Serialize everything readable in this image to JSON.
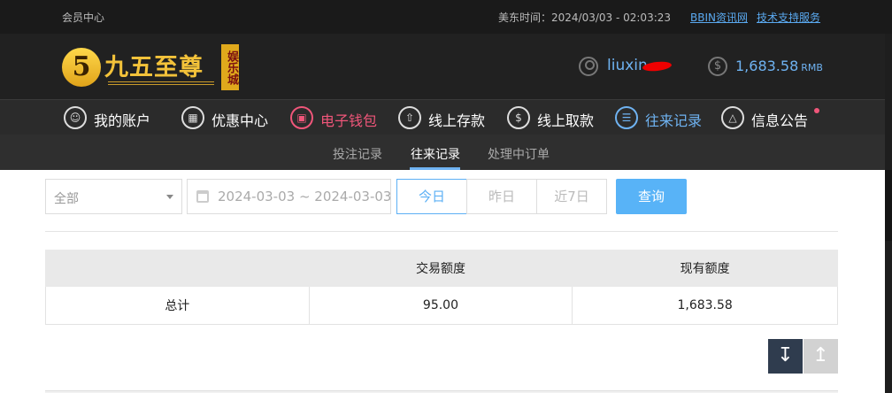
{
  "topbar": {
    "member_center": "会员中心",
    "time_label": "美东时间：2024/03/03 - 02:03:23",
    "link_bbin": "BBIN资讯网",
    "link_support": "技术支持服务"
  },
  "logo": {
    "mark": "5",
    "name": "九五至尊",
    "tag": "娱乐城"
  },
  "user": {
    "username": "liuxin",
    "balance": "1,683.58",
    "currency": "RMB",
    "balance_icon": "$"
  },
  "nav": {
    "items": [
      {
        "label": "我的账户",
        "icon": "user-icon"
      },
      {
        "label": "优惠中心",
        "icon": "gift-icon"
      },
      {
        "label": "电子钱包",
        "icon": "wallet-icon"
      },
      {
        "label": "线上存款",
        "icon": "deposit-icon"
      },
      {
        "label": "线上取款",
        "icon": "withdraw-icon"
      },
      {
        "label": "往来记录",
        "icon": "records-icon"
      },
      {
        "label": "信息公告",
        "icon": "bell-icon"
      }
    ]
  },
  "subnav": {
    "tabs": [
      {
        "label": "投注记录"
      },
      {
        "label": "往来记录"
      },
      {
        "label": "处理中订单"
      }
    ]
  },
  "filters": {
    "type_select": "全部",
    "date_range": "2024-03-03 ~ 2024-03-03",
    "quick": [
      "今日",
      "昨日",
      "近7日"
    ],
    "query_button": "查询"
  },
  "summary_table": {
    "headers": [
      "",
      "交易额度",
      "现有额度"
    ],
    "row": [
      "总计",
      "95.00",
      "1,683.58"
    ]
  },
  "colors": {
    "accent": "#58b3f7",
    "active_red": "#f0567a",
    "header_bg": "#212121"
  }
}
